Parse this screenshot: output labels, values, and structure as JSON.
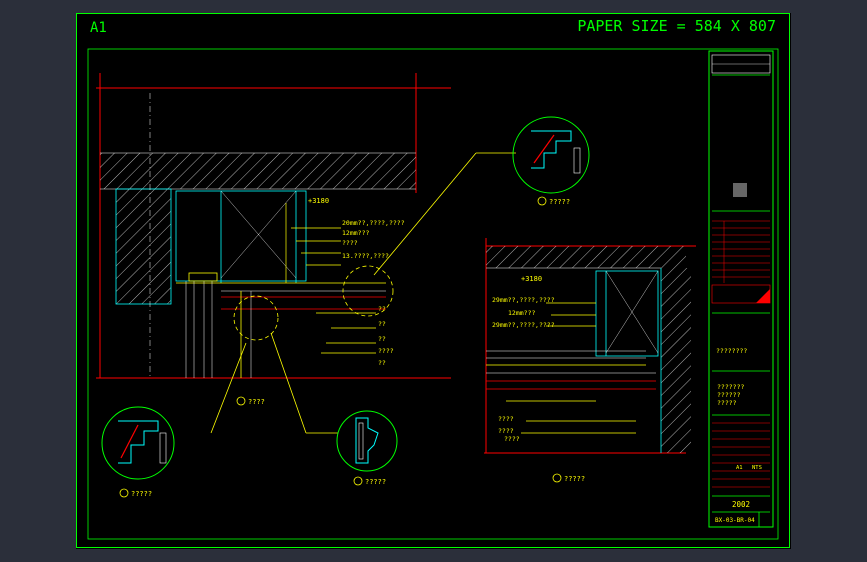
{
  "sheet": {
    "size_label": "A1",
    "paper_size": "PAPER SIZE = 584 X 807"
  },
  "main_detail": {
    "level_tag": "+3180",
    "notes": [
      "20mm??,????,????",
      "12mm???",
      "????",
      "13.????,????",
      "??",
      "??",
      "??",
      "????",
      "??"
    ],
    "caption": "????"
  },
  "right_detail": {
    "level_tag": "+3180",
    "notes": [
      "29mm??,????,????",
      "12mm???",
      "29mm??,????,????",
      "????",
      "????",
      "????"
    ],
    "caption": "?????"
  },
  "callouts": [
    {
      "caption": "?????"
    },
    {
      "caption": "?????"
    },
    {
      "caption": "?????"
    }
  ],
  "title_block": {
    "project_label": "????????",
    "sheet_title": [
      "???????",
      "??????",
      "?????"
    ],
    "scale_text": "A1",
    "ratio_text": "NTS",
    "drawing_no": "2002",
    "sheet_code": "BX-03-BR-04"
  },
  "colors": {
    "frame": "#00ff00",
    "dim": "#ffff00",
    "section": "#ff0000",
    "structure": "#00ffff",
    "hatch": "#ffffff"
  }
}
